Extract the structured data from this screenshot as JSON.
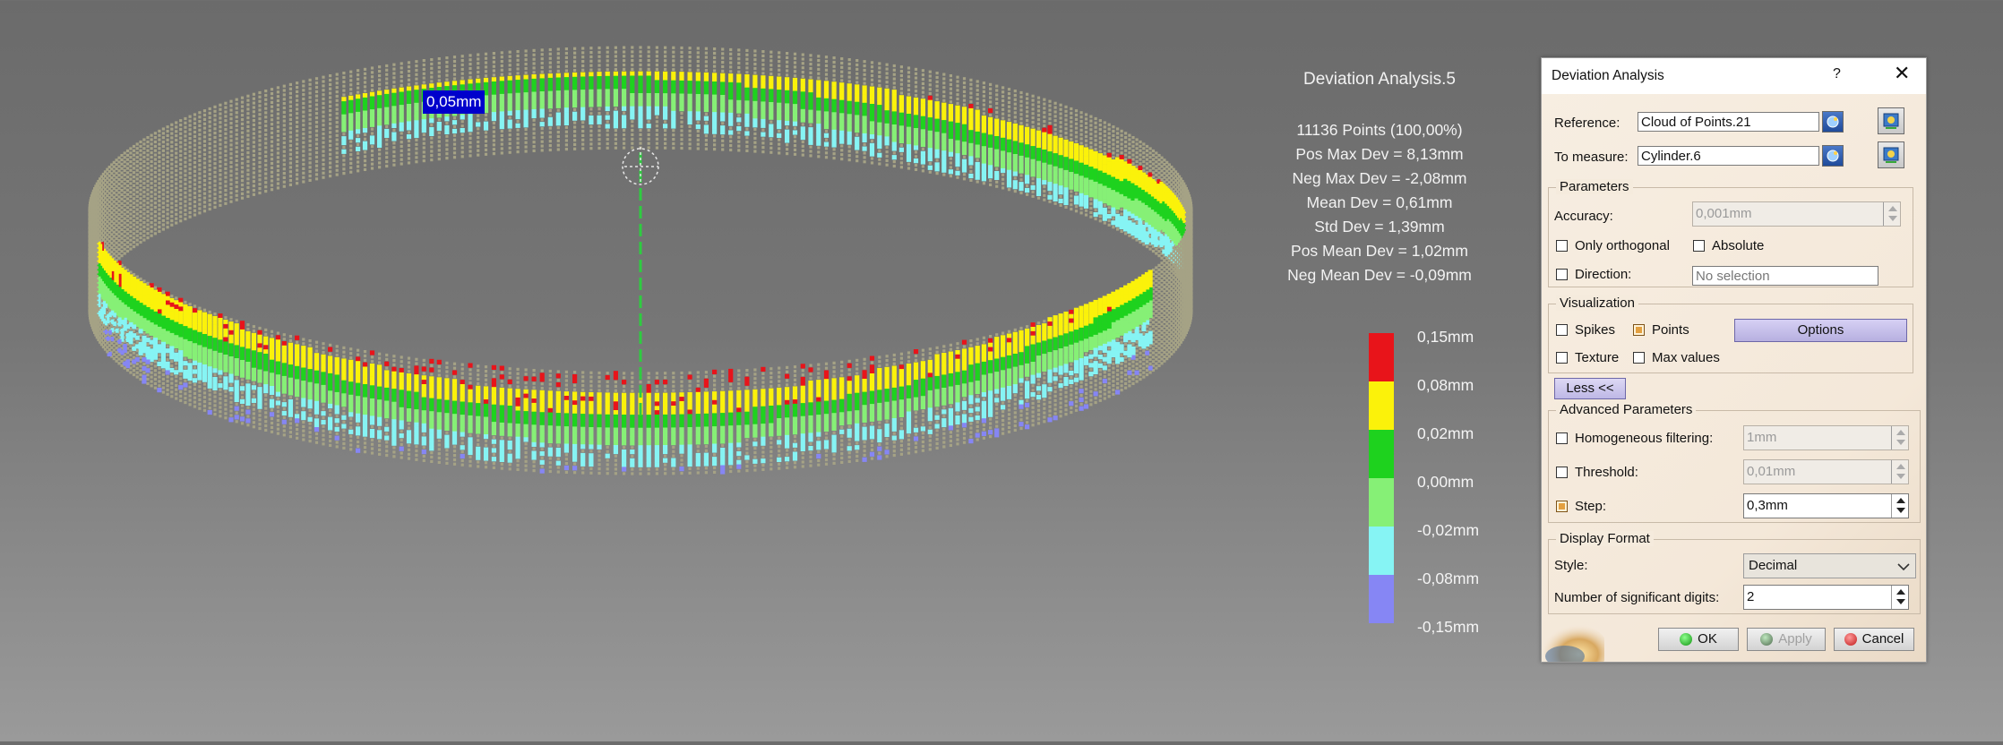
{
  "viewer": {
    "callout_label": "0,05mm",
    "analysis_title": "Deviation Analysis.5",
    "stats": [
      "11136 Points (100,00%)",
      "Pos Max Dev = 8,13mm",
      "Neg Max Dev = -2,08mm",
      "Mean Dev = 0,61mm",
      "Std Dev = 1,39mm",
      "Pos Mean Dev = 1,02mm",
      "Neg Mean Dev = -0,09mm"
    ],
    "legend": [
      {
        "label": "0,15mm",
        "color": "#e8141a"
      },
      {
        "label": "0,08mm",
        "color": "#fbf20a"
      },
      {
        "label": "0,02mm",
        "color": "#1ed21e"
      },
      {
        "label": "0,00mm",
        "color": "#86f076"
      },
      {
        "label": "-0,02mm",
        "color": "#86f4f4"
      },
      {
        "label": "-0,08mm",
        "color": "#8686f4"
      },
      {
        "label": "-0,15mm",
        "color": ""
      }
    ],
    "colors": {
      "background": "#767676",
      "grid_dots": "#a5a285",
      "red": "#e8141a",
      "yellow": "#fbf20a",
      "green": "#1ed21e",
      "light_green": "#86f076",
      "cyan": "#86f4f4",
      "blue": "#8686f4"
    }
  },
  "dialog": {
    "title": "Deviation Analysis",
    "help_label": "?",
    "close_label": "✕",
    "reference_label": "Reference:",
    "reference_value": "Cloud of Points.21",
    "to_measure_label": "To measure:",
    "to_measure_value": "Cylinder.6",
    "parameters": {
      "title": "Parameters",
      "accuracy_label": "Accuracy:",
      "accuracy_value": "0,001mm",
      "only_orthogonal_label": "Only orthogonal",
      "only_orthogonal_checked": false,
      "absolute_label": "Absolute",
      "absolute_checked": false,
      "direction_label": "Direction:",
      "direction_checked": false,
      "direction_value": "No selection"
    },
    "visualization": {
      "title": "Visualization",
      "spikes_label": "Spikes",
      "spikes_checked": false,
      "points_label": "Points",
      "points_checked": true,
      "options_label": "Options",
      "texture_label": "Texture",
      "texture_checked": false,
      "max_values_label": "Max values",
      "max_values_checked": false
    },
    "less_label": "Less <<",
    "advanced": {
      "title": "Advanced Parameters",
      "homogeneous_label": "Homogeneous filtering:",
      "homogeneous_checked": false,
      "homogeneous_value": "1mm",
      "threshold_label": "Threshold:",
      "threshold_checked": false,
      "threshold_value": "0,01mm",
      "step_label": "Step:",
      "step_checked": true,
      "step_value": "0,3mm"
    },
    "display_format": {
      "title": "Display Format",
      "style_label": "Style:",
      "style_value": "Decimal",
      "digits_label": "Number of significant digits:",
      "digits_value": "2"
    },
    "buttons": {
      "ok": "OK",
      "apply": "Apply",
      "cancel": "Cancel"
    },
    "icons": {
      "reference_select": "cloud-select-icon",
      "measure_select": "surface-select-icon",
      "swap": "swap-icon"
    }
  }
}
